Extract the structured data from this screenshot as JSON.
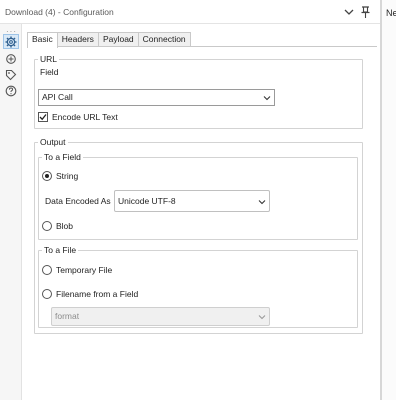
{
  "window": {
    "title": "Download (4) - Configuration",
    "right_pane_text": "Ne"
  },
  "rail": {
    "items": [
      {
        "icon": "gear-icon",
        "active": true
      },
      {
        "icon": "connection-icon",
        "active": false
      },
      {
        "icon": "tag-icon",
        "active": false
      },
      {
        "icon": "help-icon",
        "active": false
      }
    ]
  },
  "tabs": [
    {
      "label": "Basic",
      "active": true
    },
    {
      "label": "Headers",
      "active": false
    },
    {
      "label": "Payload",
      "active": false
    },
    {
      "label": "Connection",
      "active": false
    }
  ],
  "url": {
    "legend": "URL",
    "field_label": "Field",
    "field_value": "API Call",
    "encode_label": "Encode URL Text",
    "encode_checked": true
  },
  "output": {
    "legend": "Output",
    "to_field": {
      "legend": "To a Field",
      "string_label": "String",
      "string_selected": true,
      "encoding_label": "Data Encoded As",
      "encoding_value": "Unicode UTF-8",
      "blob_label": "Blob",
      "blob_selected": false
    },
    "to_file": {
      "legend": "To a File",
      "temp_label": "Temporary File",
      "temp_selected": false,
      "filename_label": "Filename from a Field",
      "filename_selected": false,
      "filename_field_value": "format"
    }
  },
  "colors": {
    "active_rail_bg": "#d9e9f7",
    "active_rail_border": "#9ec4e8",
    "title_text": "#5a5a5a",
    "disabled_text": "#8c8c8c"
  }
}
